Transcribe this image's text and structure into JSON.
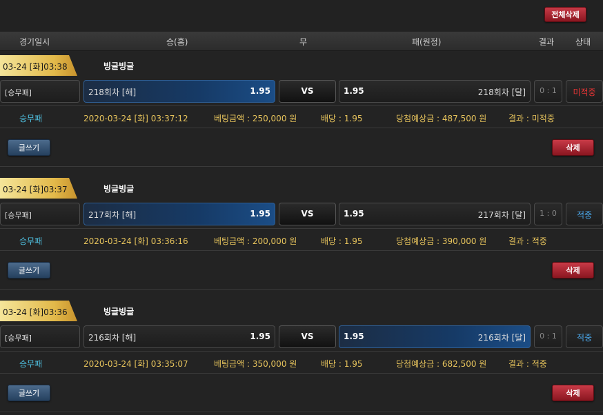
{
  "toolbar": {
    "delete_all_label": "전체삭제"
  },
  "header": {
    "col_date": "경기일시",
    "col_home": "승(홈)",
    "col_draw": "무",
    "col_away": "패(원정)",
    "col_result": "결과",
    "col_status": "상태"
  },
  "bets": [
    {
      "date": "03-24 [화]03:38",
      "league": "빙글빙글",
      "type": "[승무패]",
      "home_team": "218회차 [해]",
      "home_odd": "1.95",
      "vs": "VS",
      "away_odd": "1.95",
      "away_team": "218회차 [달]",
      "score": "0 : 1",
      "status": "미적중",
      "detail": {
        "type": "승무패",
        "datetime": "2020-03-24 [화] 03:37:12",
        "amount": "베팅금액 : 250,000 원",
        "odd": "배당 : 1.95",
        "expected": "당첨예상금 : 487,500 원",
        "result": "결과 : 미적중"
      },
      "write_label": "글쓰기",
      "delete_label": "삭제"
    },
    {
      "date": "03-24 [화]03:37",
      "league": "빙글빙글",
      "type": "[승무패]",
      "home_team": "217회차 [해]",
      "home_odd": "1.95",
      "vs": "VS",
      "away_odd": "1.95",
      "away_team": "217회차 [달]",
      "score": "1 : 0",
      "status": "적중",
      "detail": {
        "type": "승무패",
        "datetime": "2020-03-24 [화] 03:36:16",
        "amount": "베팅금액 : 200,000 원",
        "odd": "배당 : 1.95",
        "expected": "당첨예상금 : 390,000 원",
        "result": "결과 : 적중"
      },
      "write_label": "글쓰기",
      "delete_label": "삭제"
    },
    {
      "date": "03-24 [화]03:36",
      "league": "빙글빙글",
      "type": "[승무패]",
      "home_team": "216회차 [해]",
      "home_odd": "1.95",
      "vs": "VS",
      "away_odd": "1.95",
      "away_team": "216회차 [달]",
      "score": "0 : 1",
      "status": "적중",
      "detail": {
        "type": "승무패",
        "datetime": "2020-03-24 [화] 03:35:07",
        "amount": "베팅금액 : 350,000 원",
        "odd": "배당 : 1.95",
        "expected": "당첨예상금 : 682,500 원",
        "result": "결과 : 적중"
      },
      "write_label": "글쓰기",
      "delete_label": "삭제"
    }
  ],
  "colors": {
    "accent_gold": "#e2b94a",
    "selected_blue": "#163a66",
    "status_miss": "#e53434",
    "status_hit": "#4aa6e8",
    "detail_text": "#e6c35c"
  }
}
